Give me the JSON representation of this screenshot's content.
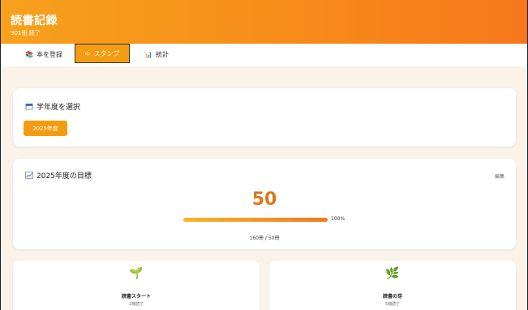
{
  "header": {
    "title": "読書記録",
    "subtitle": "301冊 読了"
  },
  "tabs": [
    {
      "label": "本を登録",
      "icon": "books-icon"
    },
    {
      "label": "スタンプ",
      "icon": "arrow-icon"
    },
    {
      "label": "統計",
      "icon": "chart-icon"
    }
  ],
  "year_card": {
    "title": "学年度を選択",
    "icon": "calendar-icon",
    "selected_year": "2025年度"
  },
  "goal_card": {
    "title": "2025年度の目標",
    "icon": "chart-up-icon",
    "edit_label": "編集",
    "goal_value": "50",
    "progress_percent_label": "100%",
    "progress_fraction": 1.0,
    "count_text": "160冊 / 50冊"
  },
  "stamps": [
    {
      "title": "読書スタート",
      "subtitle": "1冊読了",
      "icon": "seedling-icon"
    },
    {
      "title": "読書の芽",
      "subtitle": "5冊読了",
      "icon": "herb-icon"
    }
  ],
  "colors": {
    "accent": "#f39c12",
    "header_start": "#f7a11c",
    "header_end": "#f7781b",
    "goal_number": "#d9781a",
    "background": "#fbf3ea"
  }
}
